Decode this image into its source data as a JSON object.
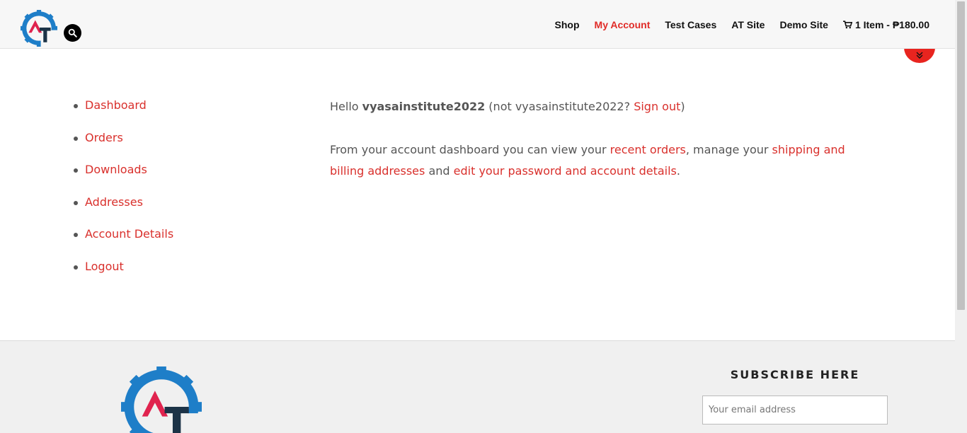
{
  "header": {
    "nav": [
      {
        "label": "Shop",
        "active": false
      },
      {
        "label": "My Account",
        "active": true
      },
      {
        "label": "Test Cases",
        "active": false
      },
      {
        "label": "AT Site",
        "active": false
      },
      {
        "label": "Demo Site",
        "active": false
      }
    ],
    "cart_label": "1 Item - ₱180.00",
    "search_icon": "search-icon",
    "cart_icon": "cart-icon"
  },
  "account_nav": [
    {
      "label": "Dashboard"
    },
    {
      "label": "Orders"
    },
    {
      "label": "Downloads"
    },
    {
      "label": "Addresses"
    },
    {
      "label": "Account Details"
    },
    {
      "label": "Logout"
    }
  ],
  "content": {
    "hello_prefix": "Hello ",
    "username": "vyasainstitute2022",
    "not_prefix": " (not vyasainstitute2022? ",
    "sign_out": "Sign out",
    "not_suffix": ")",
    "intro_text": "From your account dashboard you can view your ",
    "recent_orders": "recent orders",
    "manage_text": ", manage your ",
    "addresses_link": "shipping and billing addresses",
    "and_text": " and ",
    "password_link": "edit your password and account details",
    "end_text": "."
  },
  "footer": {
    "subscribe_title": "SUBSCRIBE HERE",
    "email_placeholder": "Your email address"
  },
  "colors": {
    "accent": "#d9302c",
    "logo_blue": "#1e7ec8",
    "logo_red": "#e0234e",
    "logo_dark": "#1c3347"
  }
}
